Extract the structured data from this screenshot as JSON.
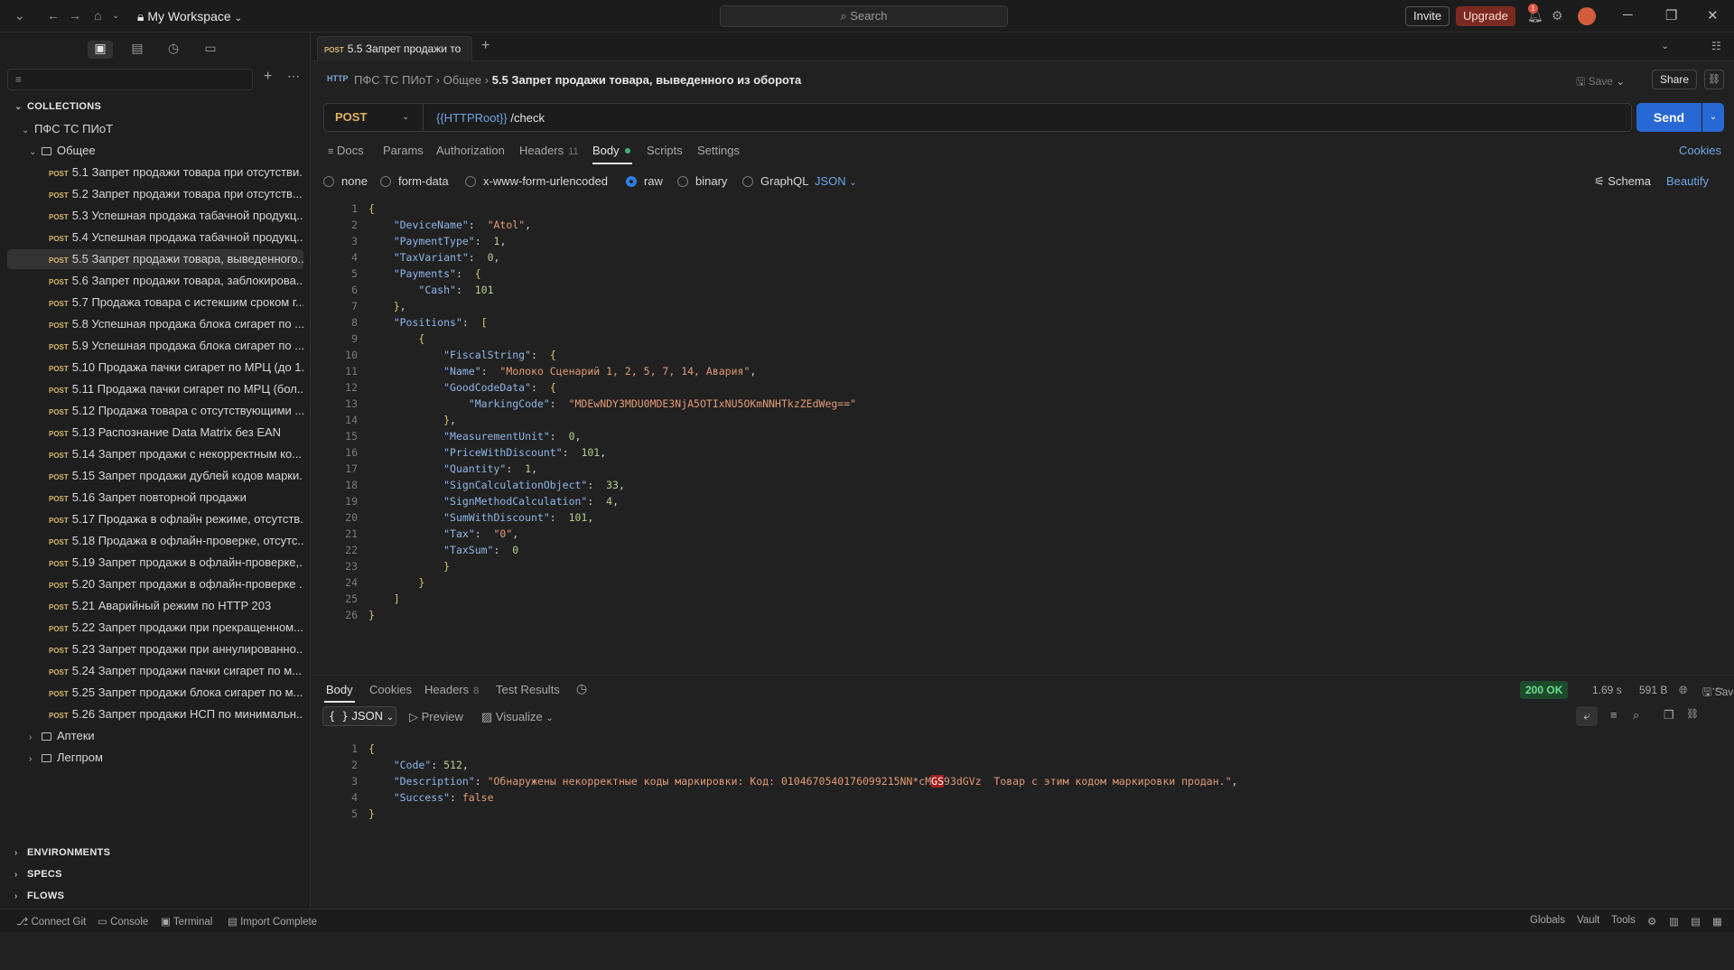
{
  "titlebar": {
    "workspace": "My Workspace",
    "search_placeholder": "Search",
    "invite": "Invite",
    "upgrade": "Upgrade",
    "notifications_count": "1"
  },
  "sidebar": {
    "collections_label": "COLLECTIONS",
    "collection_name": "ПФС ТС ПИоТ",
    "folder_open": "Общее",
    "method": "POST",
    "requests": [
      "5.1 Запрет продажи товара при отсутстви...",
      "5.2 Запрет продажи товара при отсутств...",
      "5.3 Успешная продажа табачной продукц...",
      "5.4 Успешная продажа табачной продукц...",
      "5.5 Запрет продажи товара, выведенного...",
      "5.6 Запрет продажи товара, заблокирова...",
      "5.7 Продажа товара с истекшим сроком г...",
      "5.8 Успешная продажа блока сигарет по ...",
      "5.9 Успешная продажа блока сигарет по ...",
      "5.10 Продажа пачки сигарет по МРЦ (до 1...",
      "5.11 Продажа пачки сигарет по МРЦ (бол...",
      "5.12 Продажа товара с отсутствующими ...",
      "5.13 Распознание Data Matrix без EAN",
      "5.14 Запрет продажи с некорректным ко...",
      "5.15 Запрет продажи дублей кодов марки...",
      "5.16 Запрет повторной продажи",
      "5.17 Продажа в офлайн режиме, отсутств...",
      "5.18 Продажа в офлайн-проверке, отсутс...",
      "5.19 Запрет продажи в офлайн-проверке,...",
      "5.20 Запрет продажи в офлайн-проверке ...",
      "5.21 Аварийный режим по HTTP 203",
      "5.22 Запрет продажи при прекращенном...",
      "5.23 Запрет продажи при аннулированно...",
      "5.24 Запрет продажи пачки сигарет по м...",
      "5.25 Запрет продажи блока сигарет по м...",
      "5.26 Запрет продажи НСП по минимальн..."
    ],
    "folders_closed": [
      "Аптеки",
      "Легпром"
    ],
    "bottom_sections": [
      "ENVIRONMENTS",
      "SPECS",
      "FLOWS"
    ]
  },
  "tab": {
    "method": "POST",
    "title": "5.5 Запрет продажи то"
  },
  "request": {
    "breadcrumb_collection": "ПФС ТС ПИоТ",
    "breadcrumb_folder": "Общее",
    "breadcrumb_title": "5.5 Запрет продажи товара, выведенного из оборота",
    "save": "Save",
    "share": "Share",
    "method": "POST",
    "url_var": "{{HTTPRoot}}",
    "url_path": " /check",
    "send": "Send",
    "tabs": {
      "docs": "Docs",
      "params": "Params",
      "auth": "Authorization",
      "headers": "Headers",
      "headers_count": "11",
      "body": "Body",
      "scripts": "Scripts",
      "settings": "Settings"
    },
    "cookies": "Cookies",
    "body_modes": {
      "none": "none",
      "form_data": "form-data",
      "urlencoded": "x-www-form-urlencoded",
      "raw": "raw",
      "binary": "binary",
      "graphql": "GraphQL"
    },
    "format": "JSON",
    "schema": "Schema",
    "beautify": "Beautify"
  },
  "response": {
    "tabs": {
      "body": "Body",
      "cookies": "Cookies",
      "headers": "Headers",
      "headers_count": "8",
      "tests": "Test Results"
    },
    "status": "200 OK",
    "time": "1.69 s",
    "size": "591 B",
    "save_response": "Save Response",
    "format": "JSON",
    "preview": "Preview",
    "visualize": "Visualize"
  },
  "statusbar": {
    "connect_git": "Connect Git",
    "console": "Console",
    "terminal": "Terminal",
    "import": "Import Complete",
    "globals": "Globals",
    "vault": "Vault",
    "tools": "Tools"
  }
}
